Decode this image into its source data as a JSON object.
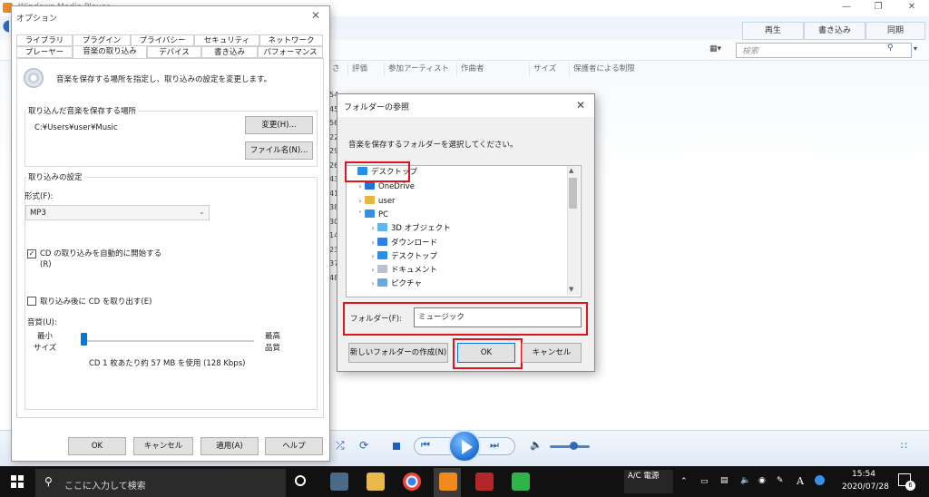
{
  "wmp": {
    "title": "Windows Media Player",
    "tabs": [
      "再生",
      "書き込み",
      "同期"
    ],
    "search_placeholder": "検索",
    "columns": [
      "さ",
      "評価",
      "参加アーティスト",
      "作曲者",
      "サイズ",
      "保護者による制限"
    ],
    "row_numbers": [
      "54",
      "45",
      "56",
      "22",
      "29",
      "26",
      "43",
      "41",
      "38",
      "30",
      "14",
      "23",
      "37",
      "48"
    ]
  },
  "options": {
    "title": "オプション",
    "tabs_row1": [
      "ライブラリ",
      "プラグイン",
      "プライバシー",
      "セキュリティ",
      "ネットワーク"
    ],
    "tabs_row2": [
      "プレーヤー",
      "音楽の取り込み",
      "デバイス",
      "書き込み",
      "パフォーマンス"
    ],
    "selected_tab": "音楽の取り込み",
    "description": "音楽を保存する場所を指定し、取り込みの設定を変更します。",
    "location_group": "取り込んだ音楽を保存する場所",
    "location_path": "C:¥Users¥user¥Music",
    "change_button": "変更(H)...",
    "filename_button": "ファイル名(N)...",
    "settings_group": "取り込みの設定",
    "format_label": "形式(F):",
    "format_value": "MP3",
    "auto_rip_label": "CD の取り込みを自動的に開始する",
    "auto_rip_suffix": "(R)",
    "auto_rip_checked": true,
    "eject_label": "取り込み後に CD を取り出す(E)",
    "eject_checked": false,
    "quality_label": "音質(U):",
    "quality_min": [
      "最小",
      "サイズ"
    ],
    "quality_max": [
      "最高",
      "品質"
    ],
    "quality_level": 0.0,
    "quality_note": "CD 1 枚あたり約 57 MB を使用 (128 Kbps)",
    "buttons": {
      "ok": "OK",
      "cancel": "キャンセル",
      "apply": "適用(A)",
      "help": "ヘルプ"
    }
  },
  "browse": {
    "title": "フォルダーの参照",
    "instruction": "音楽を保存するフォルダーを選択してください。",
    "tree": [
      {
        "label": "デスクトップ",
        "icon": "desktop-folder-icon",
        "indent": 0,
        "chevron": "",
        "selected": true
      },
      {
        "label": "OneDrive",
        "icon": "onedrive-icon",
        "indent": 1,
        "chevron": ">"
      },
      {
        "label": "user",
        "icon": "user-icon",
        "indent": 1,
        "chevron": ">"
      },
      {
        "label": "PC",
        "icon": "pc-icon",
        "indent": 1,
        "chevron": "v"
      },
      {
        "label": "3D オブジェクト",
        "icon": "3d-objects-icon",
        "indent": 2,
        "chevron": ">"
      },
      {
        "label": "ダウンロード",
        "icon": "download-icon",
        "indent": 2,
        "chevron": ">"
      },
      {
        "label": "デスクトップ",
        "icon": "desktop-folder-icon",
        "indent": 2,
        "chevron": ">"
      },
      {
        "label": "ドキュメント",
        "icon": "documents-icon",
        "indent": 2,
        "chevron": ">"
      },
      {
        "label": "ピクチャ",
        "icon": "pictures-icon",
        "indent": 2,
        "chevron": ">"
      }
    ],
    "folder_label": "フォルダー(F):",
    "folder_value": "ミュージック",
    "new_folder_button": "新しいフォルダーの作成(N)",
    "ok_button": "OK",
    "cancel_button": "キャンセル"
  },
  "taskbar": {
    "search_placeholder": "ここに入力して検索",
    "tray_text": "A/C 電源",
    "time": "15:54",
    "date": "2020/07/28",
    "notifications": "6"
  },
  "colors": {
    "highlight": "#e0141e",
    "accent": "#0078d7",
    "taskbar": "#111111"
  }
}
